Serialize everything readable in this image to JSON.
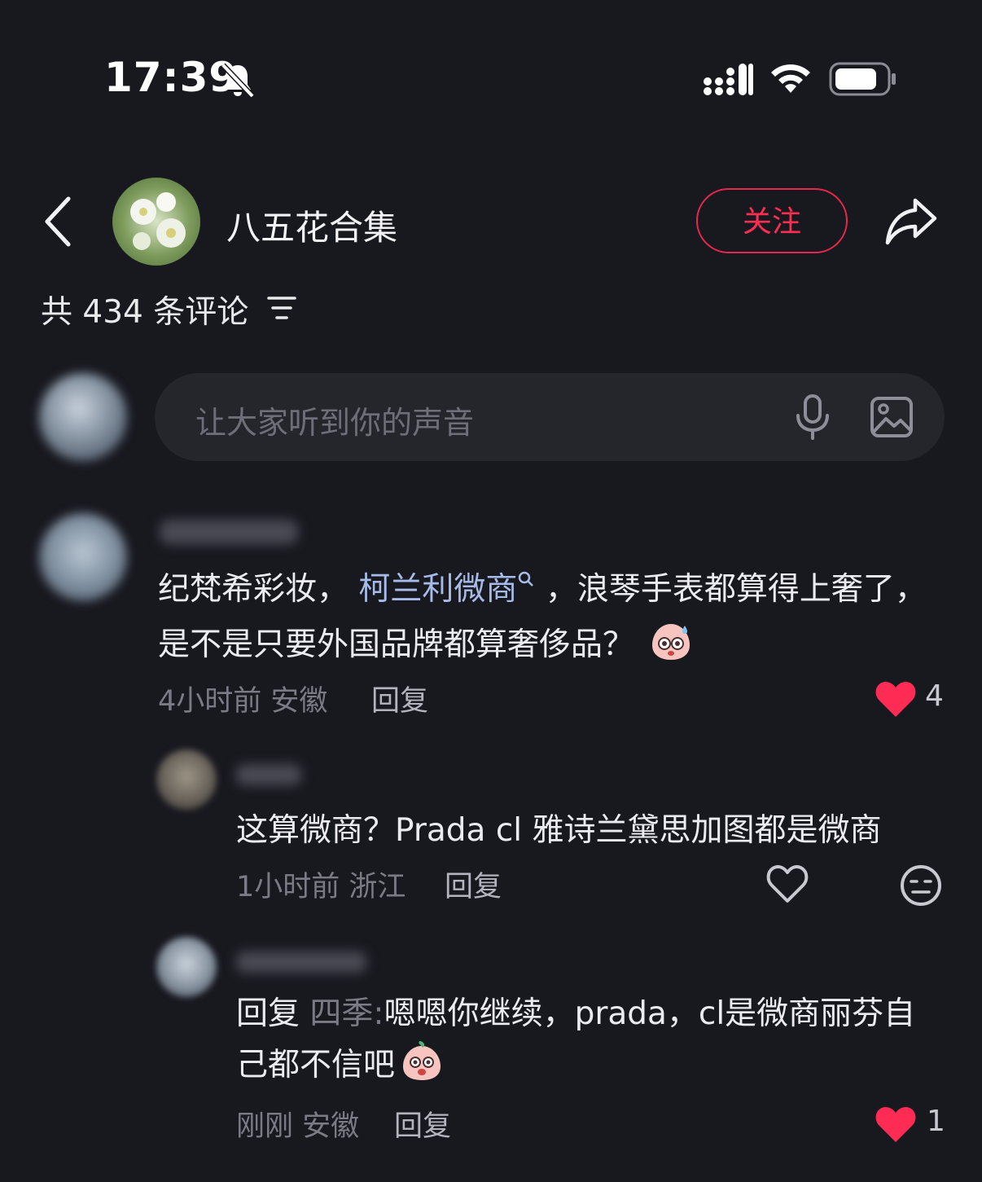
{
  "status_bar": {
    "time": "17:39",
    "icons": [
      "bell-muted-icon",
      "signal-icon",
      "wifi-icon",
      "battery-icon"
    ]
  },
  "header": {
    "channel_name": "八五花合集",
    "follow_label": "关注",
    "icons": [
      "back-icon",
      "share-icon"
    ]
  },
  "comments_summary": {
    "count_text": "共 434 条评论"
  },
  "input": {
    "placeholder": "让大家听到你的声音"
  },
  "comments": [
    {
      "text_part1": "纪梵希彩妆，",
      "link_text": "柯兰利微商",
      "text_part2": "，浪琴手表都算得上奢了，是不是只要外国品牌都算奢侈品？",
      "time": "4小时前",
      "location": "安徽",
      "reply_label": "回复",
      "likes": "4"
    }
  ],
  "replies": [
    {
      "text": "这算微商？Prada cl 雅诗兰黛思加图都是微商",
      "time": "1小时前",
      "location": "浙江",
      "reply_label": "回复"
    },
    {
      "reply_prefix": "回复",
      "reply_target": "四季:",
      "text": "嗯嗯你继续，prada，cl是微商丽芬自己都不信吧",
      "time": "刚刚",
      "location": "安徽",
      "reply_label": "回复",
      "likes": "1"
    }
  ],
  "colors": {
    "background": "#18181f",
    "accent_red": "#ff2d52",
    "link_blue": "#a7bbe8"
  }
}
